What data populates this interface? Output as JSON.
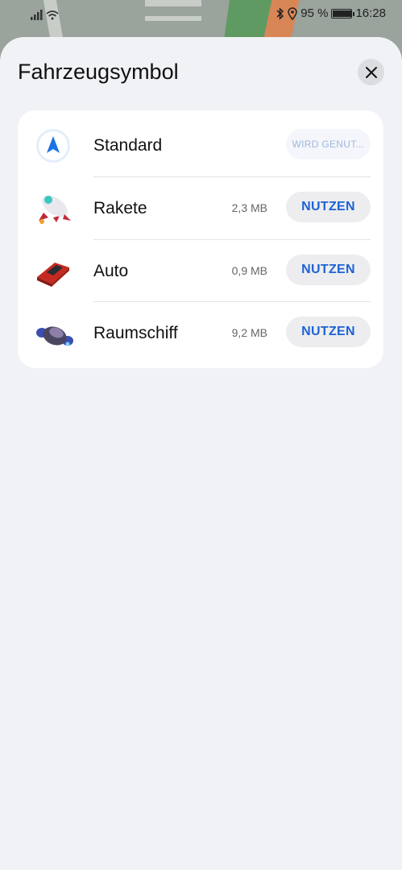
{
  "status": {
    "battery": "95 %",
    "battery_level": 0.95,
    "time": "16:28"
  },
  "sheet": {
    "title": "Fahrzeugsymbol",
    "close_icon": "close-icon"
  },
  "vehicles": [
    {
      "name": "Standard",
      "size": "",
      "button": "WIRD GENUT...",
      "icon": "navigation-arrow-icon"
    },
    {
      "name": "Rakete",
      "size": "2,3 MB",
      "button": "NUTZEN",
      "icon": "rocket-icon"
    },
    {
      "name": "Auto",
      "size": "0,9 MB",
      "button": "NUTZEN",
      "icon": "car-icon"
    },
    {
      "name": "Raumschiff",
      "size": "9,2 MB",
      "button": "NUTZEN",
      "icon": "spaceship-icon"
    }
  ],
  "colors": {
    "accent": "#1d63d4",
    "sheet_bg": "#f1f2f6"
  }
}
